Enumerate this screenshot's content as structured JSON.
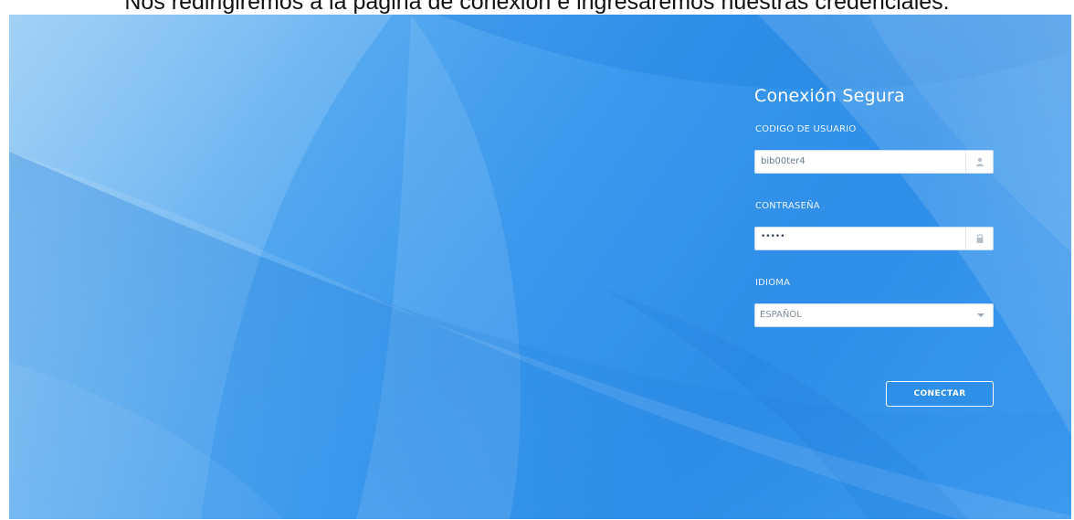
{
  "caption": "Nos redirigiremos a la página de conexión e ingresaremos nuestras credenciales.",
  "login": {
    "title": "Conexión Segura",
    "user_label": "CODIGO DE USUARIO",
    "user_value": "bib00ter4",
    "password_label": "CONTRASEÑA",
    "password_value": "•••••",
    "language_label": "IDIOMA",
    "language_value": "ESPAÑOL",
    "connect_label": "CONECTAR"
  },
  "icons": {
    "user": "user-icon",
    "lock": "lock-icon",
    "dropdown": "chevron-down-icon"
  },
  "colors": {
    "background_blue": "#3a98ec",
    "text_white": "#ffffff"
  }
}
